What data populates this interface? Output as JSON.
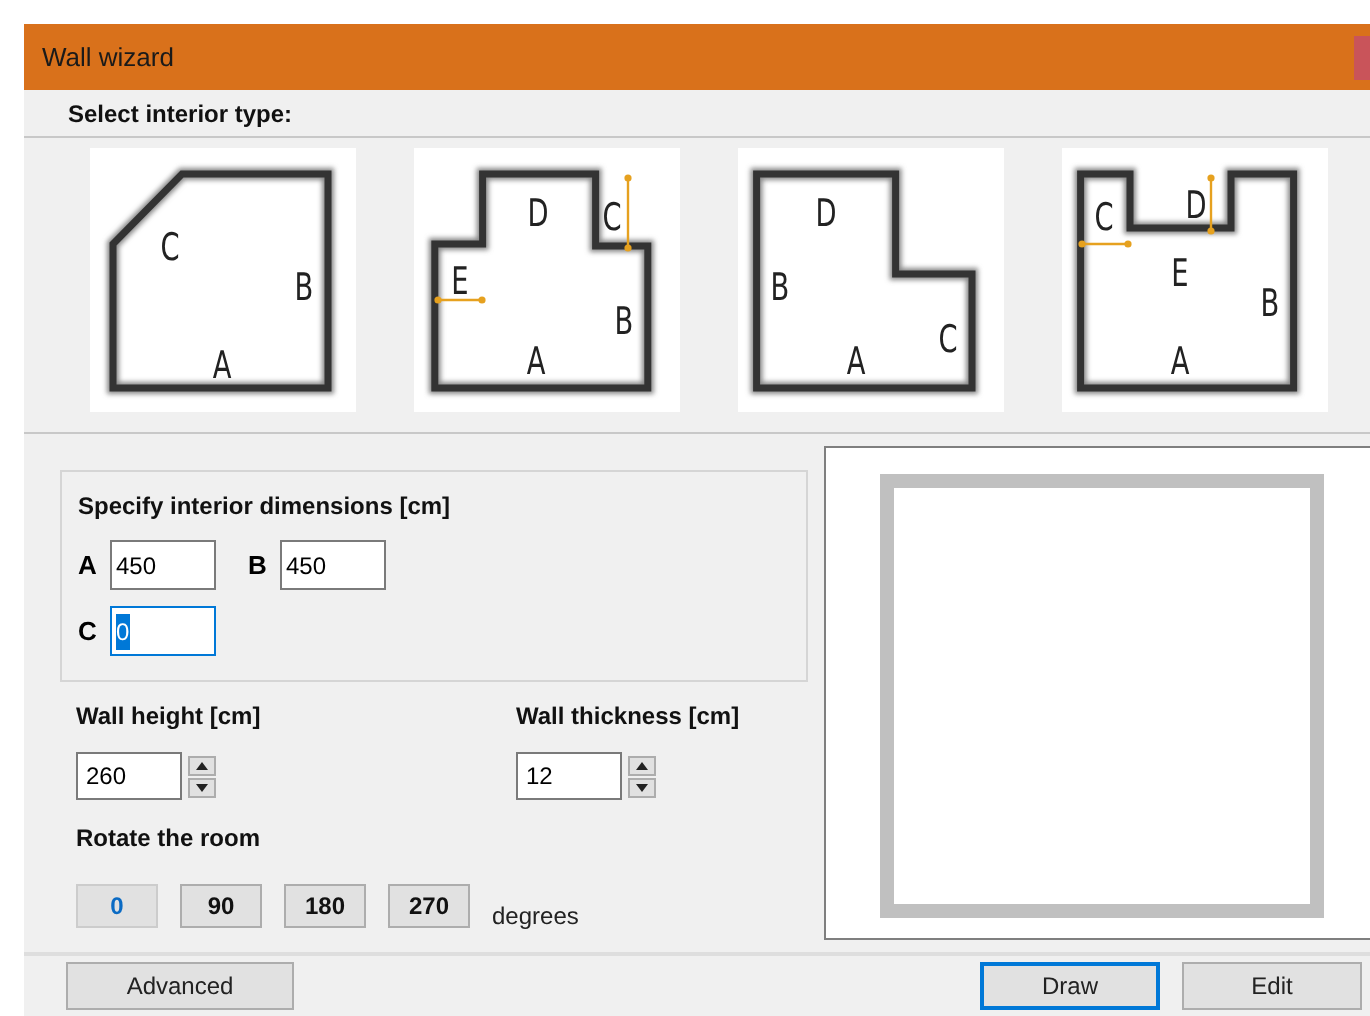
{
  "window": {
    "title": "Wall wizard"
  },
  "interior_type": {
    "label": "Select interior type:",
    "options": [
      {
        "kind": "chamfer",
        "labels": [
          "C",
          "B",
          "A"
        ]
      },
      {
        "kind": "t-shape",
        "labels": [
          "D",
          "C",
          "E",
          "B",
          "A"
        ]
      },
      {
        "kind": "l-shape",
        "labels": [
          "D",
          "B",
          "A",
          "C"
        ]
      },
      {
        "kind": "u-shape",
        "labels": [
          "C",
          "D",
          "E",
          "B",
          "A"
        ]
      }
    ]
  },
  "dimensions": {
    "title": "Specify interior dimensions [cm]",
    "fields": [
      {
        "label": "A",
        "value": "450",
        "focused": false
      },
      {
        "label": "B",
        "value": "450",
        "focused": false
      },
      {
        "label": "C",
        "value": "0",
        "focused": true
      }
    ]
  },
  "wall_height": {
    "label": "Wall height [cm]",
    "value": "260"
  },
  "wall_thickness": {
    "label": "Wall thickness [cm]",
    "value": "12"
  },
  "rotation": {
    "label": "Rotate the room",
    "options": [
      {
        "label": "0",
        "selected": true
      },
      {
        "label": "90",
        "selected": false
      },
      {
        "label": "180",
        "selected": false
      },
      {
        "label": "270",
        "selected": false
      }
    ],
    "unit": "degrees"
  },
  "buttons": [
    {
      "label": "Advanced",
      "default": false
    },
    {
      "label": "Draw",
      "default": true
    },
    {
      "label": "Edit",
      "default": false
    }
  ]
}
